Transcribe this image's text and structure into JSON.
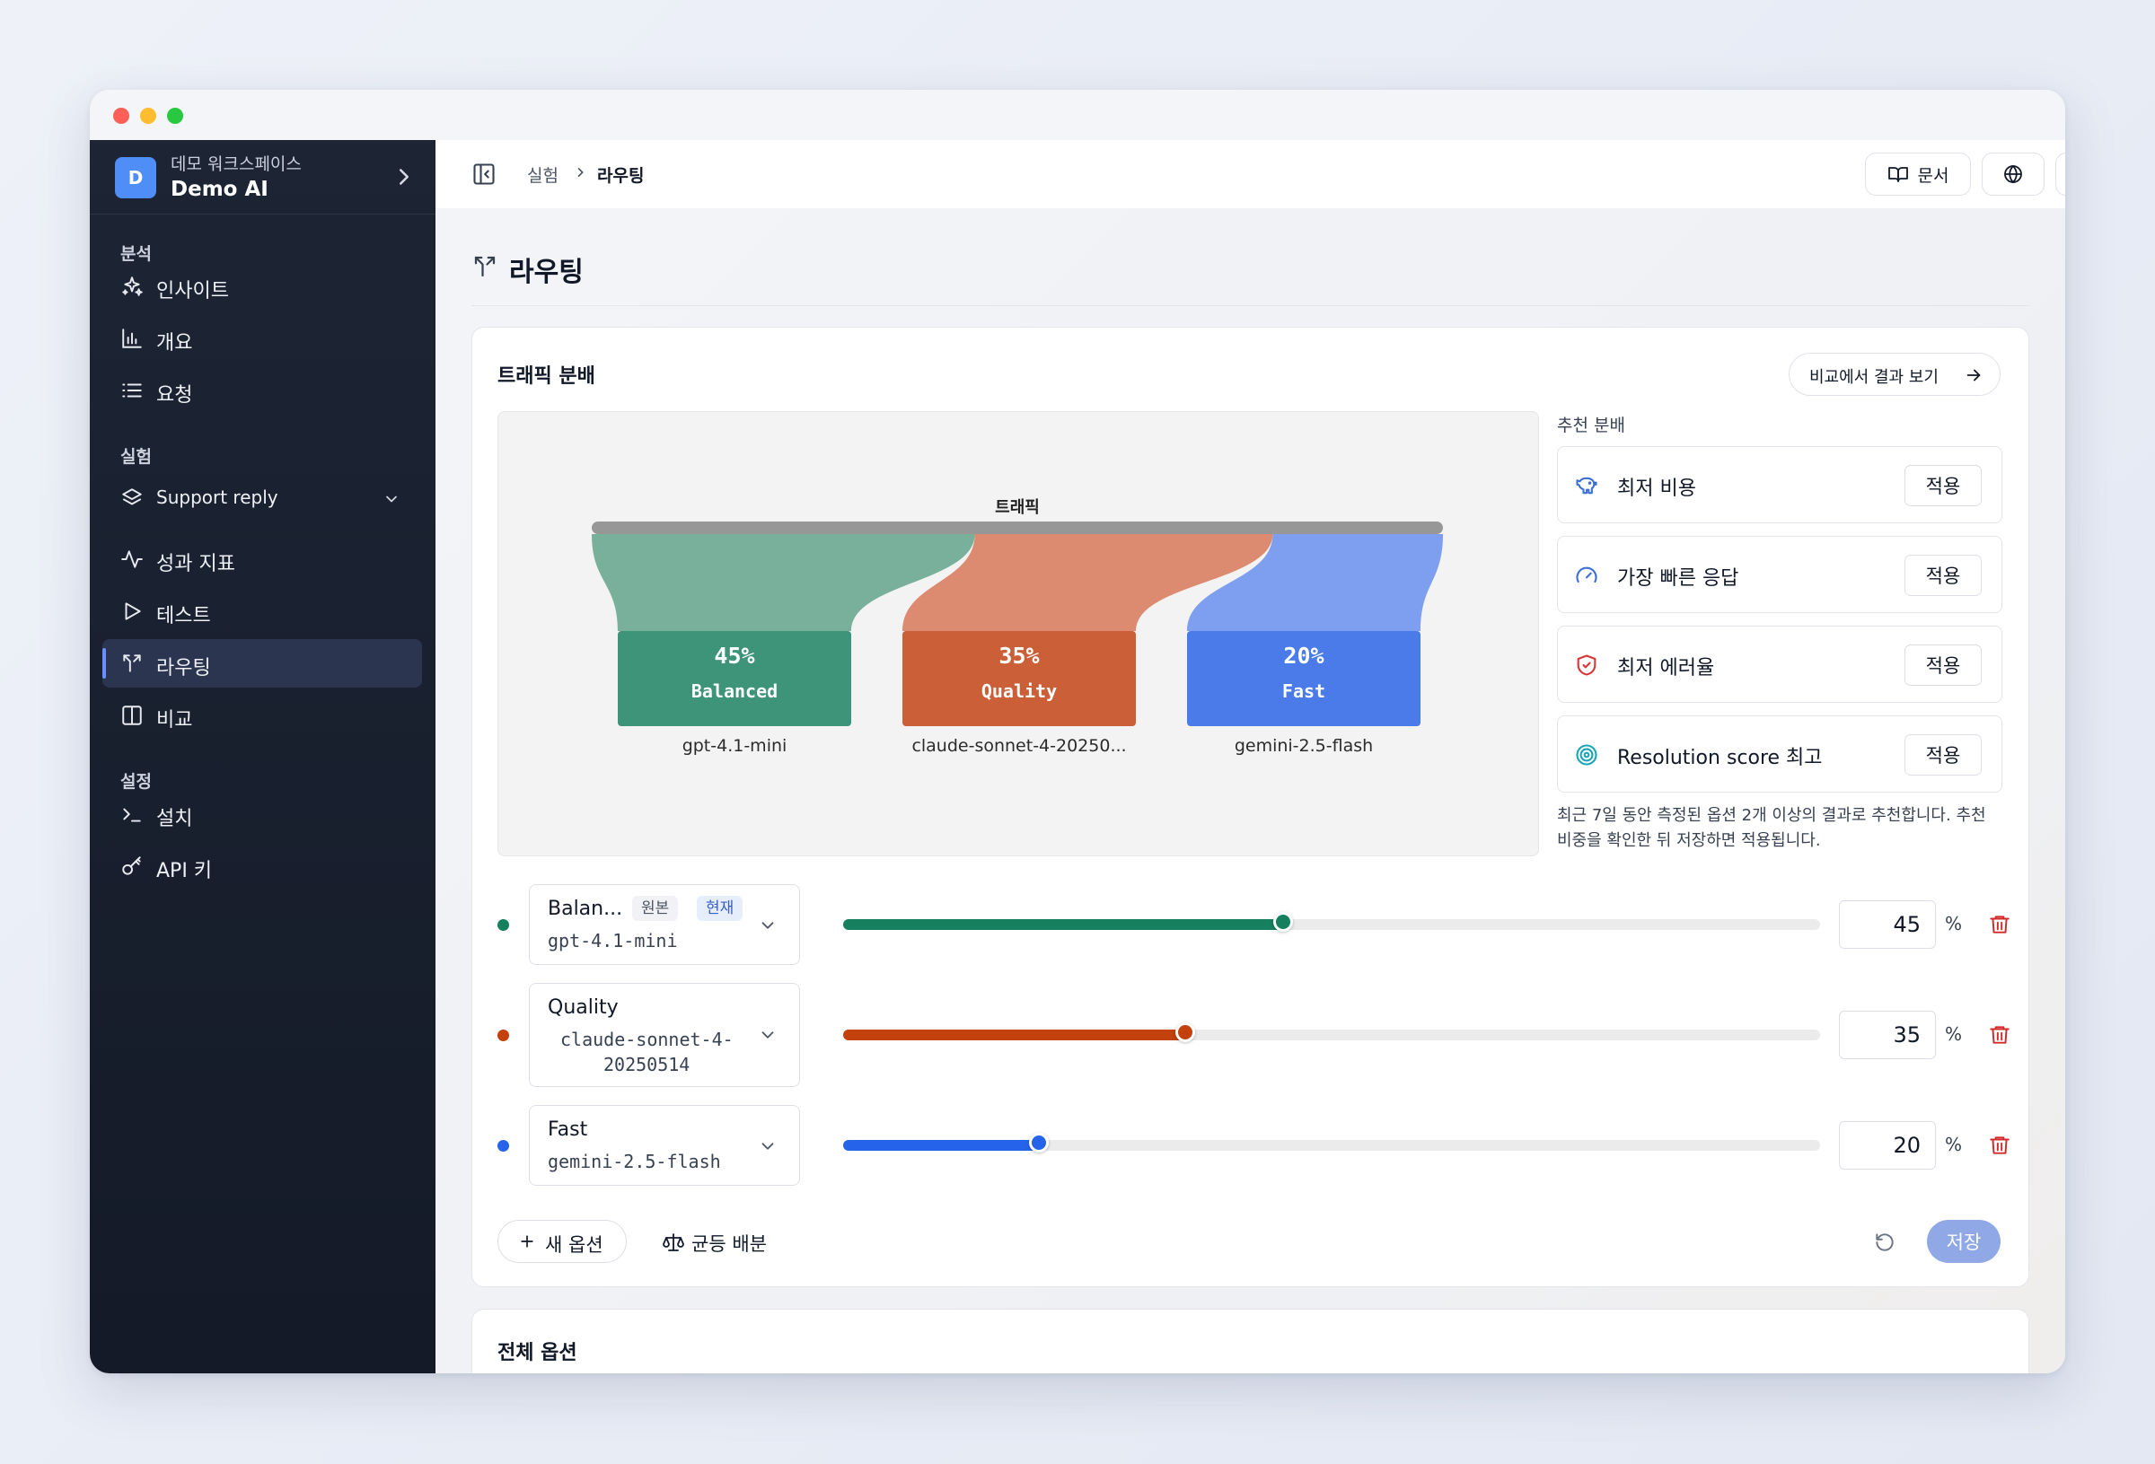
{
  "workspace": {
    "initial": "D",
    "subtitle": "데모 워크스페이스",
    "name": "Demo AI"
  },
  "sidebar": {
    "sections": [
      {
        "label": "분석",
        "items": [
          {
            "label": "인사이트",
            "icon": "sparkles-icon"
          },
          {
            "label": "개요",
            "icon": "bar-chart-icon"
          },
          {
            "label": "요청",
            "icon": "list-icon"
          }
        ]
      },
      {
        "label": "실험",
        "experiment": "Support reply",
        "items": [
          {
            "label": "성과 지표",
            "icon": "activity-icon"
          },
          {
            "label": "테스트",
            "icon": "play-icon"
          },
          {
            "label": "라우팅",
            "icon": "split-icon",
            "active": true
          },
          {
            "label": "비교",
            "icon": "columns-icon"
          }
        ]
      },
      {
        "label": "설정",
        "items": [
          {
            "label": "설치",
            "icon": "terminal-icon"
          },
          {
            "label": "API 키",
            "icon": "key-icon"
          }
        ]
      }
    ]
  },
  "topbar": {
    "breadcrumb": [
      "실험",
      "라우팅"
    ],
    "docs_label": "문서"
  },
  "page": {
    "title": "라우팅"
  },
  "traffic": {
    "title": "트래픽 분배",
    "compare_label": "비교에서 결과 보기",
    "sankey": {
      "source_label": "트래픽",
      "nodes": [
        {
          "percent": "45%",
          "name": "Balanced",
          "model": "gpt-4.1-mini",
          "color": "#3d9478",
          "flow": "#79b09c",
          "value": 45
        },
        {
          "percent": "35%",
          "name": "Quality",
          "model": "claude-sonnet-4-20250...",
          "color": "#cb5f38",
          "flow": "#dd8b70",
          "value": 35
        },
        {
          "percent": "20%",
          "name": "Fast",
          "model": "gemini-2.5-flash",
          "color": "#4a7be8",
          "flow": "#7e9fef",
          "value": 20
        }
      ]
    },
    "recommend": {
      "label": "추천 분배",
      "apply_label": "적용",
      "items": [
        {
          "label": "최저 비용",
          "icon": "piggy-bank-icon",
          "color": "#3b6fd6"
        },
        {
          "label": "가장 빠른 응답",
          "icon": "gauge-icon",
          "color": "#3b6fd6"
        },
        {
          "label": "최저 에러율",
          "icon": "shield-check-icon",
          "color": "#d93636"
        },
        {
          "label": "Resolution score 최고",
          "icon": "target-icon",
          "color": "#1aa4b8"
        }
      ],
      "note": "최근 7일 동안 측정된 옵션 2개 이상의 결과로 추천합니다. 추천 비중을 확인한 뒤 저장하면 적용됩니다."
    },
    "options": [
      {
        "name": "Balan...",
        "model": "gpt-4.1-mini",
        "badge_original": "원본",
        "badge_current": "현재",
        "value": 45,
        "color": "#157f5e"
      },
      {
        "name": "Quality",
        "model_line1": "claude-sonnet-4-",
        "model_line2": "20250514",
        "value": 35,
        "color": "#c2410c"
      },
      {
        "name": "Fast",
        "model": "gemini-2.5-flash",
        "value": 20,
        "color": "#2563eb"
      }
    ],
    "percent_sign": "%",
    "add_label": "새 옵션",
    "even_label": "균등 배분",
    "save_label": "저장"
  },
  "all_options": {
    "title": "전체 옵션"
  }
}
